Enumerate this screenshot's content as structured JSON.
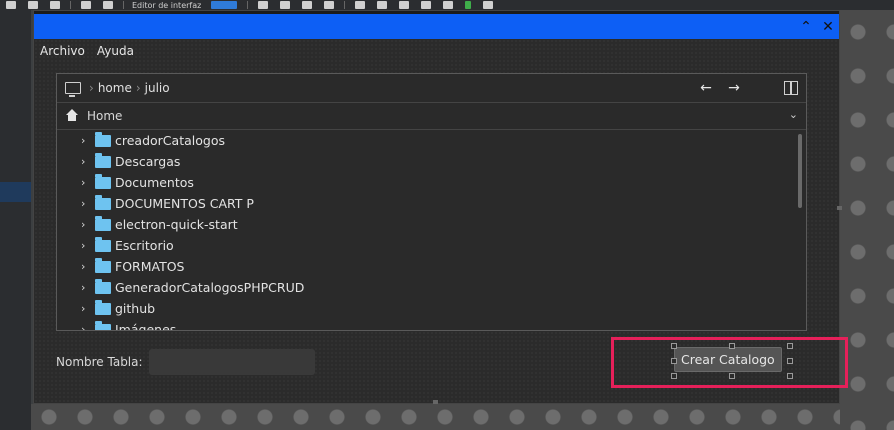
{
  "toolbar": {
    "partial_label": "Editor de interfaz"
  },
  "dialog": {
    "menu": [
      "Archivo",
      "Ayuda"
    ],
    "path": [
      "home",
      "julio"
    ],
    "location": "Home",
    "folders": [
      "creadorCatalogos",
      "Descargas",
      "Documentos",
      "DOCUMENTOS CART P",
      "electron-quick-start",
      "Escritorio",
      "FORMATOS",
      "GeneradorCatalogosPHPCRUD",
      "github",
      "Imágenes"
    ],
    "form": {
      "label": "Nombre Tabla:",
      "value": ""
    },
    "button": "Crear Catalogo",
    "colors": {
      "title_bar": "#0d5ff5",
      "highlight": "#e6205a",
      "folder": "#6ec3f0"
    }
  }
}
